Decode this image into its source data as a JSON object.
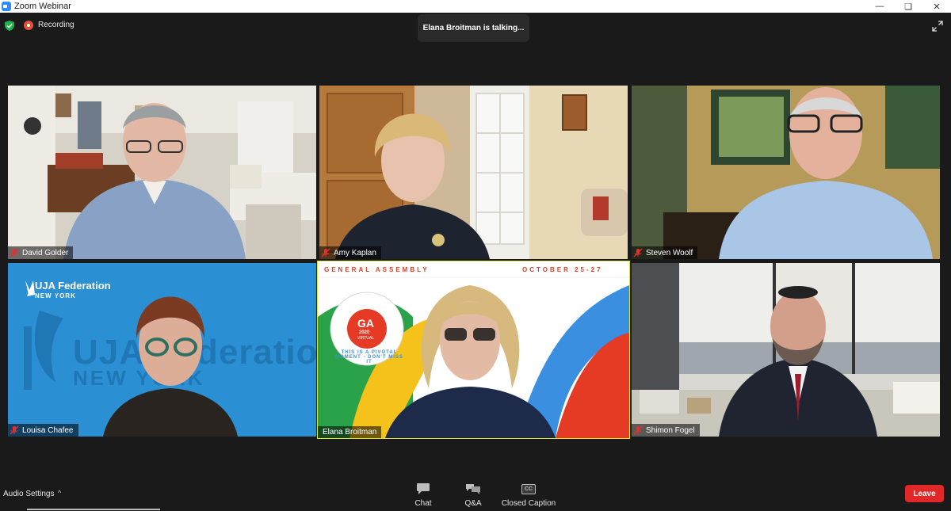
{
  "window": {
    "title": "Zoom Webinar"
  },
  "topbar": {
    "recording_label": "Recording",
    "talking_banner": "Elana Broitman is talking..."
  },
  "participants": [
    {
      "name": "David Golder"
    },
    {
      "name": "Amy Kaplan"
    },
    {
      "name": "Steven Woolf"
    },
    {
      "name": "Louisa Chafee"
    },
    {
      "name": "Elana Broitman"
    },
    {
      "name": "Shimon Fogel"
    }
  ],
  "backgrounds": {
    "uja_line1": "UJA Federation",
    "uja_line2": "NEW YORK",
    "uja_watermark1": "UJA Federation",
    "uja_watermark2": "NEW YORK",
    "ga_header_left": "GENERAL ASSEMBLY",
    "ga_header_right": "OCTOBER 25-27",
    "ga_badge_main": "GA",
    "ga_badge_year": "2020",
    "ga_badge_sub": "VIRTUAL",
    "ga_ring_text": "THIS IS A PIVOTAL MOMENT · DON'T MISS IT"
  },
  "bottombar": {
    "audio_settings": "Audio Settings",
    "chat": "Chat",
    "qa": "Q&A",
    "closed_caption": "Closed Caption",
    "cc_icon_text": "CC",
    "leave": "Leave"
  },
  "colors": {
    "leave": "#e02828",
    "active_speaker": "#e5e52a",
    "mute": "#e0312f"
  }
}
